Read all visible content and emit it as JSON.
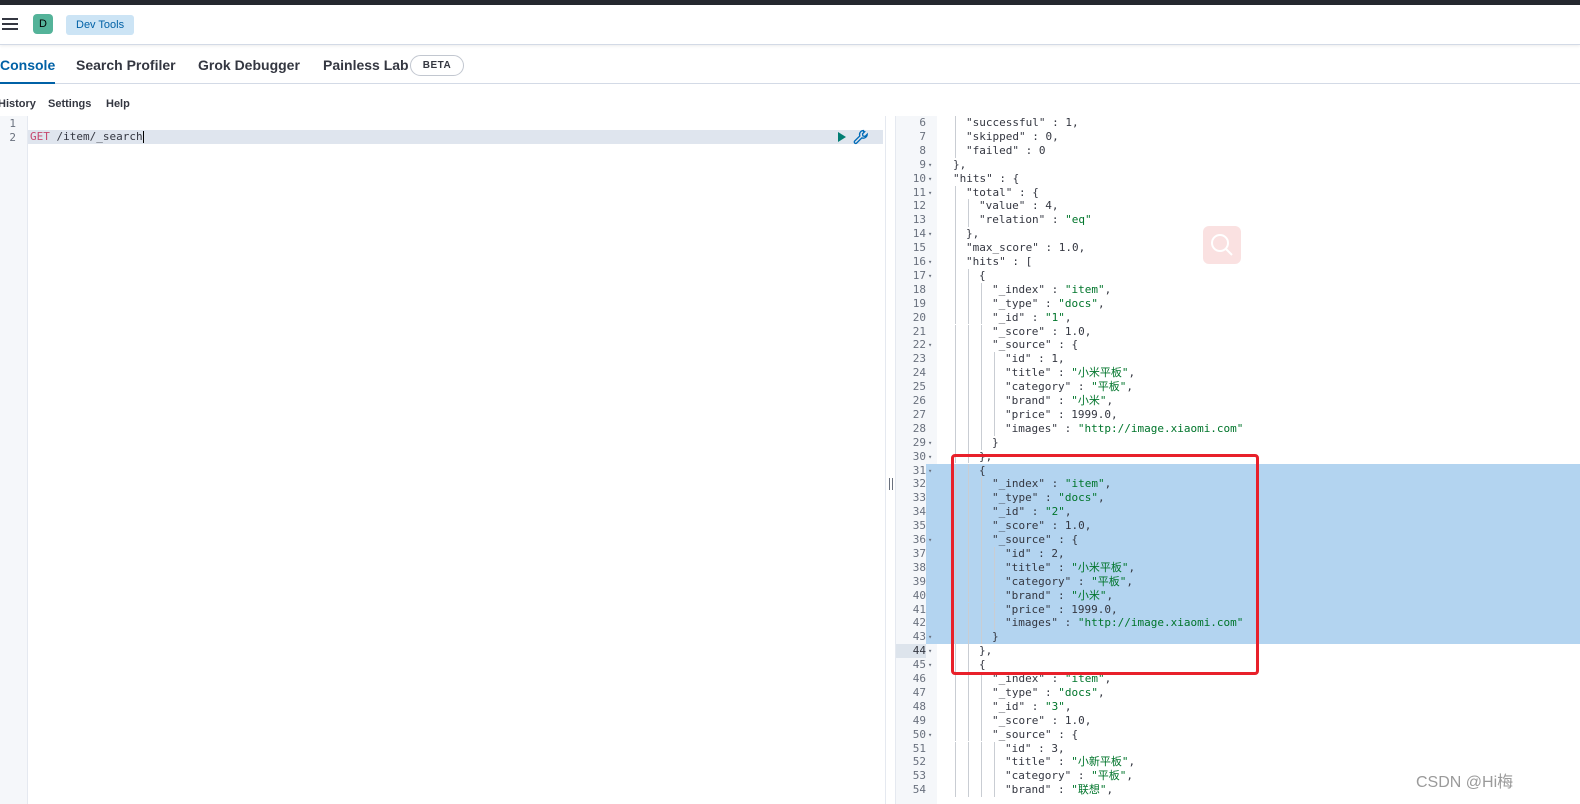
{
  "header": {
    "space_initial": "D",
    "breadcrumb": "Dev Tools"
  },
  "tabs": [
    {
      "label": "Console",
      "active": true
    },
    {
      "label": "Search Profiler",
      "active": false
    },
    {
      "label": "Grok Debugger",
      "active": false
    },
    {
      "label": "Painless Lab",
      "active": false
    }
  ],
  "beta_badge": "BETA",
  "subnav": {
    "history": "History",
    "settings": "Settings",
    "help": "Help"
  },
  "request": {
    "line_numbers": [
      "1",
      "2"
    ],
    "method": "GET",
    "path": " /item/_search"
  },
  "response_lines": [
    {
      "n": "6",
      "fold": false,
      "indent": 1,
      "parts": [
        [
          "k",
          "\"successful\""
        ],
        [
          "p",
          " : "
        ],
        [
          "n",
          "1"
        ],
        [
          "p",
          ","
        ]
      ]
    },
    {
      "n": "7",
      "fold": false,
      "indent": 1,
      "parts": [
        [
          "k",
          "\"skipped\""
        ],
        [
          "p",
          " : "
        ],
        [
          "n",
          "0"
        ],
        [
          "p",
          ","
        ]
      ]
    },
    {
      "n": "8",
      "fold": false,
      "indent": 1,
      "parts": [
        [
          "k",
          "\"failed\""
        ],
        [
          "p",
          " : "
        ],
        [
          "n",
          "0"
        ]
      ]
    },
    {
      "n": "9",
      "fold": true,
      "indent": 0,
      "parts": [
        [
          "p",
          "},"
        ]
      ]
    },
    {
      "n": "10",
      "fold": true,
      "indent": 0,
      "parts": [
        [
          "k",
          "\"hits\""
        ],
        [
          "p",
          " : {"
        ]
      ]
    },
    {
      "n": "11",
      "fold": true,
      "indent": 1,
      "parts": [
        [
          "k",
          "\"total\""
        ],
        [
          "p",
          " : {"
        ]
      ]
    },
    {
      "n": "12",
      "fold": false,
      "indent": 2,
      "parts": [
        [
          "k",
          "\"value\""
        ],
        [
          "p",
          " : "
        ],
        [
          "n",
          "4"
        ],
        [
          "p",
          ","
        ]
      ]
    },
    {
      "n": "13",
      "fold": false,
      "indent": 2,
      "parts": [
        [
          "k",
          "\"relation\""
        ],
        [
          "p",
          " : "
        ],
        [
          "s",
          "\"eq\""
        ]
      ]
    },
    {
      "n": "14",
      "fold": true,
      "indent": 1,
      "parts": [
        [
          "p",
          "},"
        ]
      ]
    },
    {
      "n": "15",
      "fold": false,
      "indent": 1,
      "parts": [
        [
          "k",
          "\"max_score\""
        ],
        [
          "p",
          " : "
        ],
        [
          "n",
          "1.0"
        ],
        [
          "p",
          ","
        ]
      ]
    },
    {
      "n": "16",
      "fold": true,
      "indent": 1,
      "parts": [
        [
          "k",
          "\"hits\""
        ],
        [
          "p",
          " : ["
        ]
      ]
    },
    {
      "n": "17",
      "fold": true,
      "indent": 2,
      "parts": [
        [
          "p",
          "{"
        ]
      ]
    },
    {
      "n": "18",
      "fold": false,
      "indent": 3,
      "parts": [
        [
          "k",
          "\"_index\""
        ],
        [
          "p",
          " : "
        ],
        [
          "s",
          "\"item\""
        ],
        [
          "p",
          ","
        ]
      ]
    },
    {
      "n": "19",
      "fold": false,
      "indent": 3,
      "parts": [
        [
          "k",
          "\"_type\""
        ],
        [
          "p",
          " : "
        ],
        [
          "s",
          "\"docs\""
        ],
        [
          "p",
          ","
        ]
      ]
    },
    {
      "n": "20",
      "fold": false,
      "indent": 3,
      "parts": [
        [
          "k",
          "\"_id\""
        ],
        [
          "p",
          " : "
        ],
        [
          "s",
          "\"1\""
        ],
        [
          "p",
          ","
        ]
      ]
    },
    {
      "n": "21",
      "fold": false,
      "indent": 3,
      "parts": [
        [
          "k",
          "\"_score\""
        ],
        [
          "p",
          " : "
        ],
        [
          "n",
          "1.0"
        ],
        [
          "p",
          ","
        ]
      ]
    },
    {
      "n": "22",
      "fold": true,
      "indent": 3,
      "parts": [
        [
          "k",
          "\"_source\""
        ],
        [
          "p",
          " : {"
        ]
      ]
    },
    {
      "n": "23",
      "fold": false,
      "indent": 4,
      "parts": [
        [
          "k",
          "\"id\""
        ],
        [
          "p",
          " : "
        ],
        [
          "n",
          "1"
        ],
        [
          "p",
          ","
        ]
      ]
    },
    {
      "n": "24",
      "fold": false,
      "indent": 4,
      "parts": [
        [
          "k",
          "\"title\""
        ],
        [
          "p",
          " : "
        ],
        [
          "s",
          "\"小米平板\""
        ],
        [
          "p",
          ","
        ]
      ]
    },
    {
      "n": "25",
      "fold": false,
      "indent": 4,
      "parts": [
        [
          "k",
          "\"category\""
        ],
        [
          "p",
          " : "
        ],
        [
          "s",
          "\"平板\""
        ],
        [
          "p",
          ","
        ]
      ]
    },
    {
      "n": "26",
      "fold": false,
      "indent": 4,
      "parts": [
        [
          "k",
          "\"brand\""
        ],
        [
          "p",
          " : "
        ],
        [
          "s",
          "\"小米\""
        ],
        [
          "p",
          ","
        ]
      ]
    },
    {
      "n": "27",
      "fold": false,
      "indent": 4,
      "parts": [
        [
          "k",
          "\"price\""
        ],
        [
          "p",
          " : "
        ],
        [
          "n",
          "1999.0"
        ],
        [
          "p",
          ","
        ]
      ]
    },
    {
      "n": "28",
      "fold": false,
      "indent": 4,
      "parts": [
        [
          "k",
          "\"images\""
        ],
        [
          "p",
          " : "
        ],
        [
          "s",
          "\"http://image.xiaomi.com\""
        ]
      ]
    },
    {
      "n": "29",
      "fold": true,
      "indent": 3,
      "parts": [
        [
          "p",
          "}"
        ]
      ]
    },
    {
      "n": "30",
      "fold": true,
      "indent": 2,
      "parts": [
        [
          "p",
          "},"
        ]
      ]
    },
    {
      "n": "31",
      "fold": true,
      "indent": 2,
      "sel": true,
      "parts": [
        [
          "p",
          "{"
        ]
      ]
    },
    {
      "n": "32",
      "fold": false,
      "indent": 3,
      "sel": true,
      "parts": [
        [
          "k",
          "\"_index\""
        ],
        [
          "p",
          " : "
        ],
        [
          "s",
          "\"item\""
        ],
        [
          "p",
          ","
        ]
      ]
    },
    {
      "n": "33",
      "fold": false,
      "indent": 3,
      "sel": true,
      "parts": [
        [
          "k",
          "\"_type\""
        ],
        [
          "p",
          " : "
        ],
        [
          "s",
          "\"docs\""
        ],
        [
          "p",
          ","
        ]
      ]
    },
    {
      "n": "34",
      "fold": false,
      "indent": 3,
      "sel": true,
      "parts": [
        [
          "k",
          "\"_id\""
        ],
        [
          "p",
          " : "
        ],
        [
          "s",
          "\"2\""
        ],
        [
          "p",
          ","
        ]
      ]
    },
    {
      "n": "35",
      "fold": false,
      "indent": 3,
      "sel": true,
      "parts": [
        [
          "k",
          "\"_score\""
        ],
        [
          "p",
          " : "
        ],
        [
          "n",
          "1.0"
        ],
        [
          "p",
          ","
        ]
      ]
    },
    {
      "n": "36",
      "fold": true,
      "indent": 3,
      "sel": true,
      "parts": [
        [
          "k",
          "\"_source\""
        ],
        [
          "p",
          " : {"
        ]
      ]
    },
    {
      "n": "37",
      "fold": false,
      "indent": 4,
      "sel": true,
      "parts": [
        [
          "k",
          "\"id\""
        ],
        [
          "p",
          " : "
        ],
        [
          "n",
          "2"
        ],
        [
          "p",
          ","
        ]
      ]
    },
    {
      "n": "38",
      "fold": false,
      "indent": 4,
      "sel": true,
      "parts": [
        [
          "k",
          "\"title\""
        ],
        [
          "p",
          " : "
        ],
        [
          "s",
          "\"小米平板\""
        ],
        [
          "p",
          ","
        ]
      ]
    },
    {
      "n": "39",
      "fold": false,
      "indent": 4,
      "sel": true,
      "parts": [
        [
          "k",
          "\"category\""
        ],
        [
          "p",
          " : "
        ],
        [
          "s",
          "\"平板\""
        ],
        [
          "p",
          ","
        ]
      ]
    },
    {
      "n": "40",
      "fold": false,
      "indent": 4,
      "sel": true,
      "parts": [
        [
          "k",
          "\"brand\""
        ],
        [
          "p",
          " : "
        ],
        [
          "s",
          "\"小米\""
        ],
        [
          "p",
          ","
        ]
      ]
    },
    {
      "n": "41",
      "fold": false,
      "indent": 4,
      "sel": true,
      "parts": [
        [
          "k",
          "\"price\""
        ],
        [
          "p",
          " : "
        ],
        [
          "n",
          "1999.0"
        ],
        [
          "p",
          ","
        ]
      ]
    },
    {
      "n": "42",
      "fold": false,
      "indent": 4,
      "sel": true,
      "parts": [
        [
          "k",
          "\"images\""
        ],
        [
          "p",
          " : "
        ],
        [
          "s",
          "\"http://image.xiaomi.com\""
        ]
      ]
    },
    {
      "n": "43",
      "fold": true,
      "indent": 3,
      "sel": true,
      "parts": [
        [
          "p",
          "}"
        ]
      ]
    },
    {
      "n": "44",
      "fold": true,
      "indent": 2,
      "cur": true,
      "parts": [
        [
          "p",
          "},"
        ]
      ]
    },
    {
      "n": "45",
      "fold": true,
      "indent": 2,
      "parts": [
        [
          "p",
          "{"
        ]
      ]
    },
    {
      "n": "46",
      "fold": false,
      "indent": 3,
      "parts": [
        [
          "k",
          "\"_index\""
        ],
        [
          "p",
          " : "
        ],
        [
          "s",
          "\"item\""
        ],
        [
          "p",
          ","
        ]
      ]
    },
    {
      "n": "47",
      "fold": false,
      "indent": 3,
      "parts": [
        [
          "k",
          "\"_type\""
        ],
        [
          "p",
          " : "
        ],
        [
          "s",
          "\"docs\""
        ],
        [
          "p",
          ","
        ]
      ]
    },
    {
      "n": "48",
      "fold": false,
      "indent": 3,
      "parts": [
        [
          "k",
          "\"_id\""
        ],
        [
          "p",
          " : "
        ],
        [
          "s",
          "\"3\""
        ],
        [
          "p",
          ","
        ]
      ]
    },
    {
      "n": "49",
      "fold": false,
      "indent": 3,
      "parts": [
        [
          "k",
          "\"_score\""
        ],
        [
          "p",
          " : "
        ],
        [
          "n",
          "1.0"
        ],
        [
          "p",
          ","
        ]
      ]
    },
    {
      "n": "50",
      "fold": true,
      "indent": 3,
      "parts": [
        [
          "k",
          "\"_source\""
        ],
        [
          "p",
          " : {"
        ]
      ]
    },
    {
      "n": "51",
      "fold": false,
      "indent": 4,
      "parts": [
        [
          "k",
          "\"id\""
        ],
        [
          "p",
          " : "
        ],
        [
          "n",
          "3"
        ],
        [
          "p",
          ","
        ]
      ]
    },
    {
      "n": "52",
      "fold": false,
      "indent": 4,
      "parts": [
        [
          "k",
          "\"title\""
        ],
        [
          "p",
          " : "
        ],
        [
          "s",
          "\"小新平板\""
        ],
        [
          "p",
          ","
        ]
      ]
    },
    {
      "n": "53",
      "fold": false,
      "indent": 4,
      "parts": [
        [
          "k",
          "\"category\""
        ],
        [
          "p",
          " : "
        ],
        [
          "s",
          "\"平板\""
        ],
        [
          "p",
          ","
        ]
      ]
    },
    {
      "n": "54",
      "fold": false,
      "indent": 4,
      "parts": [
        [
          "k",
          "\"brand\""
        ],
        [
          "p",
          " : "
        ],
        [
          "s",
          "\"联想\""
        ],
        [
          "p",
          ","
        ]
      ]
    }
  ],
  "icons": {
    "menu": "hamburger-icon",
    "run": "play-icon",
    "wrench": "wrench-icon",
    "search": "search-icon"
  },
  "colors": {
    "accent": "#0061a6",
    "string": "#00752b",
    "method": "#c6486e",
    "selection": "#b3d4f0",
    "annotation": "#e8202a"
  },
  "watermark": "CSDN @Hi梅"
}
